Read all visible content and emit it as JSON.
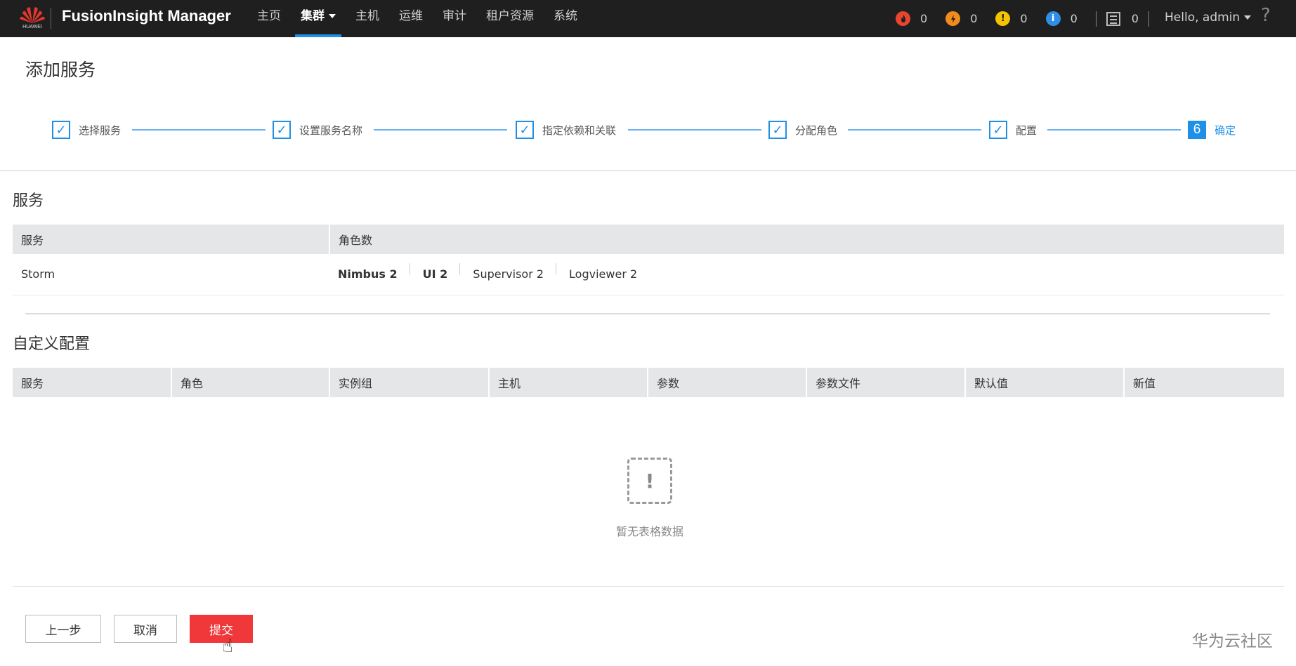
{
  "brand": {
    "logo_text": "HUAWEI",
    "app_title": "FusionInsight Manager"
  },
  "nav": [
    {
      "label": "主页"
    },
    {
      "label": "集群",
      "active": true
    },
    {
      "label": "主机"
    },
    {
      "label": "运维"
    },
    {
      "label": "审计"
    },
    {
      "label": "租户资源"
    },
    {
      "label": "系统"
    }
  ],
  "alarms": [
    {
      "icon": "critical-alarm-icon",
      "color": "#e8452f",
      "count": "0"
    },
    {
      "icon": "major-alarm-icon",
      "color": "#f08c1e",
      "count": "0"
    },
    {
      "icon": "minor-alarm-icon",
      "color": "#f5c400",
      "count": "0"
    },
    {
      "icon": "warning-alarm-icon",
      "color": "#2f8fe8",
      "count": "0"
    }
  ],
  "task_count": "0",
  "user": {
    "greeting": "Hello, admin"
  },
  "help": "?",
  "page": {
    "title": "添加服务"
  },
  "steps": [
    {
      "label": "选择服务",
      "done": true
    },
    {
      "label": "设置服务名称",
      "done": true
    },
    {
      "label": "指定依赖和关联",
      "done": true
    },
    {
      "label": "分配角色",
      "done": true
    },
    {
      "label": "配置",
      "done": true
    },
    {
      "label": "确定",
      "number": "6",
      "current": true
    }
  ],
  "services_section": {
    "title": "服务",
    "headers": [
      "服务",
      "角色数"
    ],
    "rows": [
      {
        "service": "Storm",
        "roles": [
          "Nimbus 2",
          "UI 2",
          "Supervisor 2",
          "Logviewer 2"
        ]
      }
    ]
  },
  "custom_config": {
    "title": "自定义配置",
    "headers": [
      "服务",
      "角色",
      "实例组",
      "主机",
      "参数",
      "参数文件",
      "默认值",
      "新值"
    ],
    "empty_text": "暂无表格数据"
  },
  "buttons": {
    "prev": "上一步",
    "cancel": "取消",
    "submit": "提交"
  },
  "watermark": "华为云社区",
  "colors": {
    "accent": "#1e90e8",
    "primary_button": "#f0373a",
    "topbar": "#1f1f1f"
  }
}
